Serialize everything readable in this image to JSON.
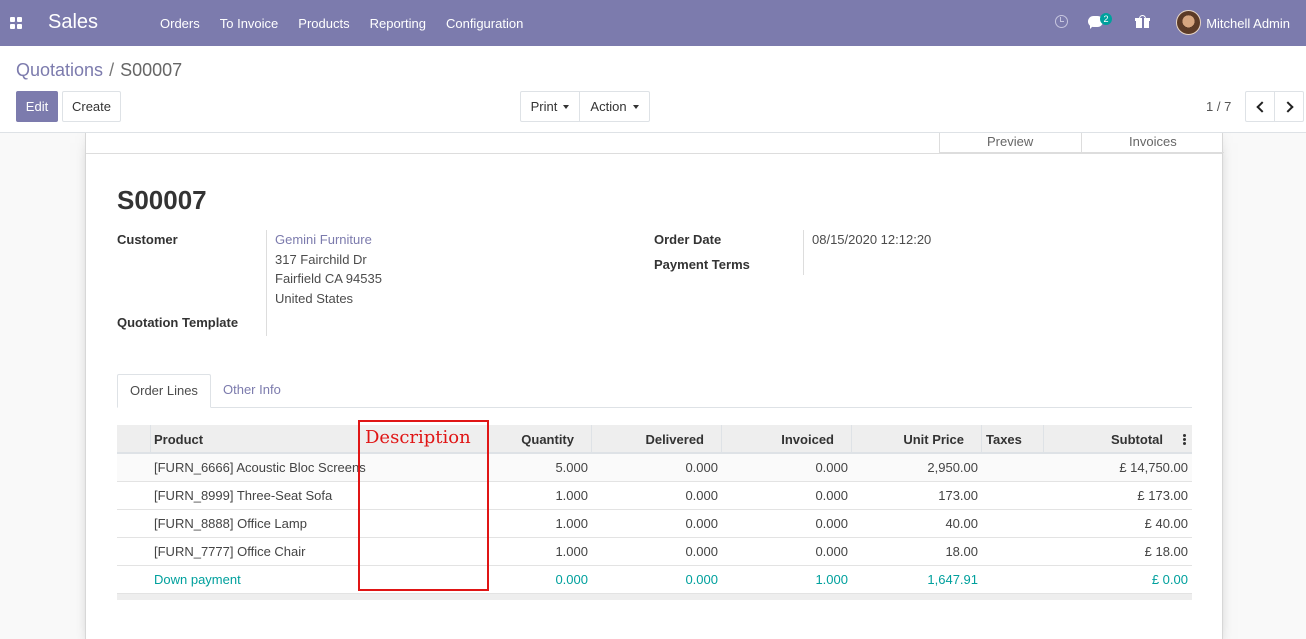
{
  "navbar": {
    "app_name": "Sales",
    "menu": [
      "Orders",
      "To Invoice",
      "Products",
      "Reporting",
      "Configuration"
    ],
    "messages_count": "2",
    "user_name": "Mitchell Admin",
    "icons": [
      "apps-icon",
      "clock-icon",
      "chat-icon",
      "gift-icon",
      "avatar"
    ]
  },
  "breadcrumb": {
    "parent": "Quotations",
    "separator": "/",
    "current": "S00007"
  },
  "buttons": {
    "edit": "Edit",
    "create": "Create",
    "print": "Print",
    "action": "Action"
  },
  "pager": {
    "value": "1 / 7"
  },
  "smart_buttons": {
    "preview": "Preview",
    "invoices": "Invoices"
  },
  "form": {
    "title": "S00007",
    "customer_label": "Customer",
    "customer_name": "Gemini Furniture",
    "address": [
      "317 Fairchild Dr",
      "Fairfield CA 94535",
      "United States"
    ],
    "quotation_template_label": "Quotation Template",
    "order_date_label": "Order Date",
    "order_date": "08/15/2020 12:12:20",
    "payment_terms_label": "Payment Terms"
  },
  "tabs": [
    "Order Lines",
    "Other Info"
  ],
  "table": {
    "headers": {
      "product": "Product",
      "quantity": "Quantity",
      "delivered": "Delivered",
      "invoiced": "Invoiced",
      "unit_price": "Unit Price",
      "taxes": "Taxes",
      "subtotal": "Subtotal"
    },
    "rows": [
      {
        "product": "[FURN_6666] Acoustic Bloc Screens",
        "quantity": "5.000",
        "delivered": "0.000",
        "invoiced": "0.000",
        "unit_price": "2,950.00",
        "subtotal": "£ 14,750.00"
      },
      {
        "product": "[FURN_8999] Three-Seat Sofa",
        "quantity": "1.000",
        "delivered": "0.000",
        "invoiced": "0.000",
        "unit_price": "173.00",
        "subtotal": "£ 173.00"
      },
      {
        "product": "[FURN_8888] Office Lamp",
        "quantity": "1.000",
        "delivered": "0.000",
        "invoiced": "0.000",
        "unit_price": "40.00",
        "subtotal": "£ 40.00"
      },
      {
        "product": "[FURN_7777] Office Chair",
        "quantity": "1.000",
        "delivered": "0.000",
        "invoiced": "0.000",
        "unit_price": "18.00",
        "subtotal": "£ 18.00"
      },
      {
        "product": "Down payment",
        "quantity": "0.000",
        "delivered": "0.000",
        "invoiced": "1.000",
        "unit_price": "1,647.91",
        "subtotal": "£ 0.00"
      }
    ]
  },
  "annotation": {
    "label": "Description",
    "color": "#e01515"
  },
  "colors": {
    "brand": "#7c7bad",
    "down_payment": "#00a09d"
  }
}
